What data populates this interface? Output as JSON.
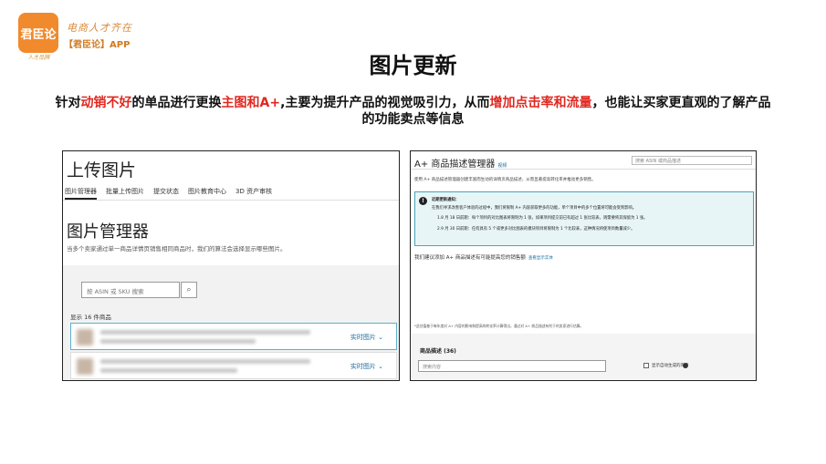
{
  "brand": {
    "logo_text": "君臣论",
    "logo_sub": "人才品牌",
    "slogan": "电商人才齐在",
    "app_name": "【君臣论】APP"
  },
  "slide": {
    "title": "图片更新",
    "subtitle": {
      "p1": "针对",
      "p2": "动销不好",
      "p3": "的单品进行更换",
      "p4": "主图和A+",
      "p5": ",主要为提升产品的视觉吸引力，从而",
      "p6": "增加点击率和流量",
      "p7": "，也能让买家更直观的了解产品的功能卖点等信息"
    }
  },
  "upload_panel": {
    "title": "上传图片",
    "tabs": [
      "图片管理器",
      "批量上传图片",
      "提交状态",
      "图片教育中心",
      "3D 资产审核"
    ],
    "manager_title": "图片管理器",
    "manager_desc": "当多个卖家通过单一商品详情页销售相同商品时，我们的算法会选择显示哪些图片。",
    "search_placeholder": "按 ASIN 或 SKU 搜索",
    "count_text": "显示 16 件商品",
    "row_link": "实时图片 ⌄"
  },
  "aplus_panel": {
    "title": "A+ 商品描述管理器",
    "title_tag": "视频",
    "search_placeholder": "搜索 ASIN 或商品描述",
    "intro": "使用 A+ 商品描述管理器创建丰富而生动的详情页商品描述，从而显著提高转化率并推动更多销售。",
    "notice_title": "近期更新通知：",
    "notice_line1": "在我们寻求改善客户体验的过程中，我们将限制 A+ 内容获取更多的功能，单个项目中的多个位置将可能会受到影响。",
    "notice_line2": "1.8 月 18 日前期：每个项目的对比图表将限制为 1 张，如果项目提交前已有超过 1 张比较表，则需要将其保留为 1 张。",
    "notice_line3": "2.9 月 30 日前期：任何具有 5 个或更多对比图表的模块项目将限制为 1 个比较表，这种情况将使项目数量减少。",
    "recommend": "我们建议添加 A+ 商品描述有可能提高您的销售额",
    "recommend_link": "查看显示实体",
    "footnote": "*此估值基于每年度对 A+ 内容的影响和提高的转化率计算得出，通过对 A+ 商品描述有利于的卖家进行估算。",
    "desc_title": "商品描述 (36)",
    "desc_search_placeholder": "搜索内容",
    "checkbox_label": "显示自动生成的内容"
  }
}
